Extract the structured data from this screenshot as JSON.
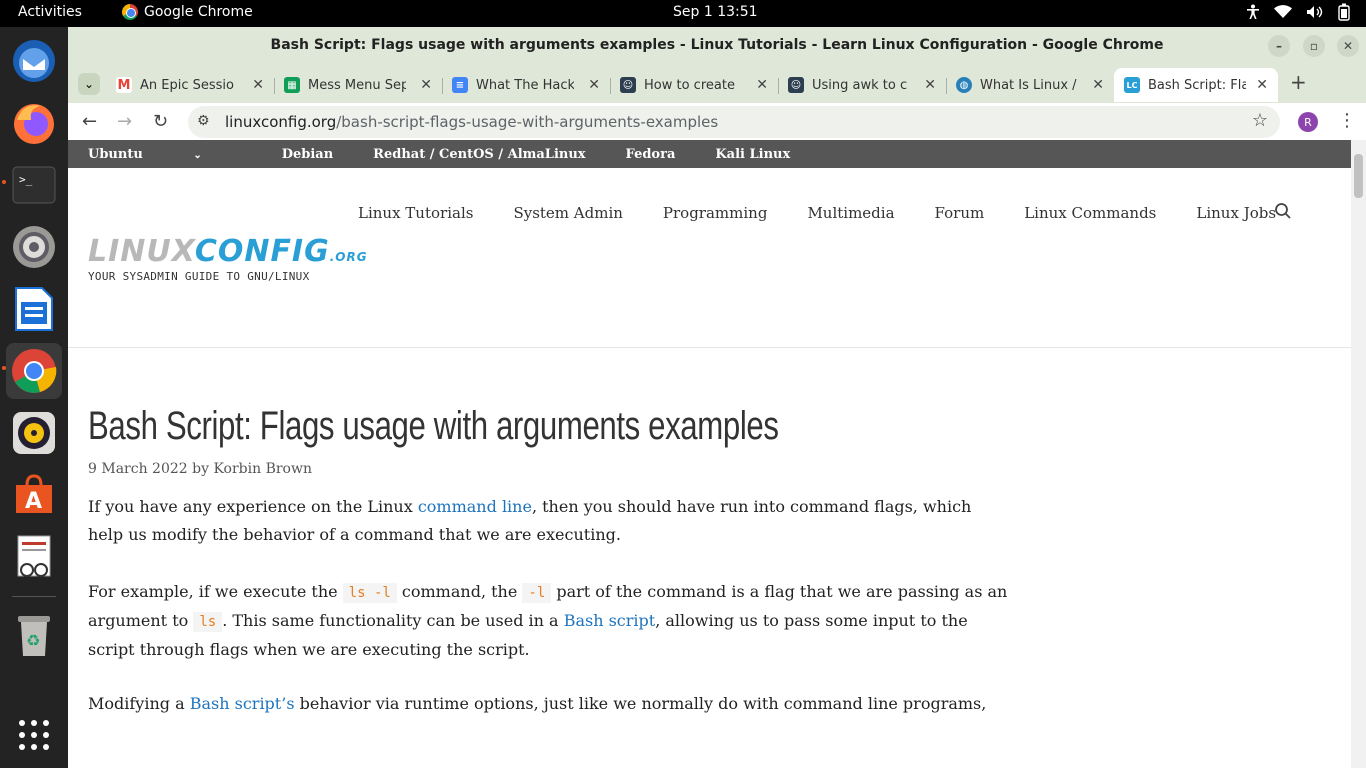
{
  "topbar": {
    "activities": "Activities",
    "app_name": "Google Chrome",
    "clock": "Sep 1  13:51"
  },
  "window": {
    "title": "Bash Script: Flags usage with arguments examples - Linux Tutorials - Learn Linux Configuration - Google Chrome"
  },
  "tabs": [
    {
      "label": "An Epic Sessio",
      "favicon": "gmail-icon",
      "color": "#ea4335"
    },
    {
      "label": "Mess Menu Sep",
      "favicon": "sheets-icon",
      "color": "#0f9d58"
    },
    {
      "label": "What The Hack",
      "favicon": "docs-icon",
      "color": "#4285f4"
    },
    {
      "label": "How to create",
      "favicon": "person-icon",
      "color": "#2c3e50"
    },
    {
      "label": "Using awk to c",
      "favicon": "person-icon",
      "color": "#2c3e50"
    },
    {
      "label": "What Is Linux /",
      "favicon": "globe-icon",
      "color": "#2980b9"
    },
    {
      "label": "Bash Script: Fla",
      "favicon": "lc-icon",
      "color": "#2a9fd6"
    }
  ],
  "omnibox": {
    "host": "linuxconfig.org",
    "path": "/bash-script-flags-usage-with-arguments-examples"
  },
  "profile_initial": "R",
  "distro_nav": [
    "Ubuntu",
    "Debian",
    "Redhat / CentOS / AlmaLinux",
    "Fedora",
    "Kali Linux"
  ],
  "logo": {
    "part1": "LINUX",
    "part2": "CONFIG",
    "suffix": ".ORG",
    "tagline": "YOUR SYSADMIN GUIDE TO GNU/LINUX"
  },
  "main_nav": [
    "Linux Tutorials",
    "System Admin",
    "Programming",
    "Multimedia",
    "Forum",
    "Linux Commands",
    "Linux Jobs"
  ],
  "article": {
    "title": "Bash Script: Flags usage with arguments examples",
    "date": "9 March 2022",
    "by": "by",
    "author": "Korbin Brown",
    "p1_a": "If you have any experience on the Linux ",
    "p1_link": "command line",
    "p1_b": ", then you should have run into command flags, which help us modify the behavior of a command that we are executing.",
    "p2_a": "For example, if we execute the ",
    "p2_code1": "ls -l",
    "p2_b": " command, the ",
    "p2_code2": "-l",
    "p2_c": " part of the command is a flag that we are passing as an argument to ",
    "p2_code3": "ls",
    "p2_d": ". This same functionality can be used in a ",
    "p2_link": "Bash script",
    "p2_e": ", allowing us to pass some input to the script through flags when we are executing the script.",
    "p3_a": "Modifying a ",
    "p3_link": "Bash script’s",
    "p3_b": " behavior via runtime options, just like we normally do with command line programs,"
  }
}
